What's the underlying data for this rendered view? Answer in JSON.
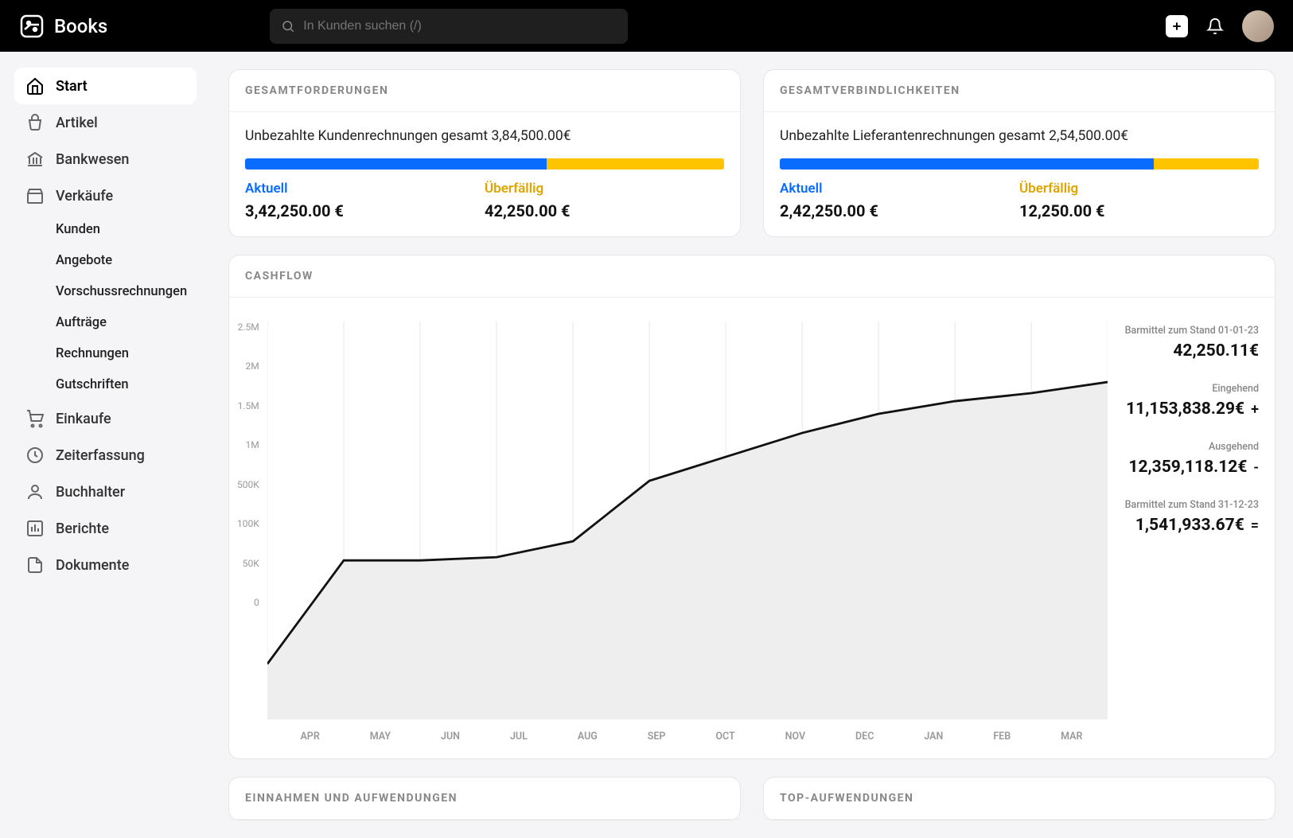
{
  "brand": "Books",
  "search": {
    "placeholder": "In Kunden suchen (/)"
  },
  "sidebar": {
    "items": [
      {
        "label": "Start",
        "icon": "home",
        "active": true
      },
      {
        "label": "Artikel",
        "icon": "basket"
      },
      {
        "label": "Bankwesen",
        "icon": "bank"
      },
      {
        "label": "Verkäufe",
        "icon": "store",
        "children": [
          "Kunden",
          "Angebote",
          "Vorschussrechnungen",
          "Aufträge",
          "Rechnungen",
          "Gutschriften"
        ]
      },
      {
        "label": "Einkaufe",
        "icon": "cart"
      },
      {
        "label": "Zeiterfassung",
        "icon": "clock"
      },
      {
        "label": "Buchhalter",
        "icon": "person"
      },
      {
        "label": "Berichte",
        "icon": "chart"
      },
      {
        "label": "Dokumente",
        "icon": "file"
      }
    ]
  },
  "receivables": {
    "title": "GESAMTFORDERUNGEN",
    "summary": "Unbezahlte Kundenrechnungen gesamt 3,84,500.00€",
    "current_label": "Aktuell",
    "current_value": "3,42,250.00 €",
    "overdue_label": "Überfällig",
    "overdue_value": "42,250.00 €",
    "bar_split_pct": 63
  },
  "payables": {
    "title": "GESAMTVERBINDLICHKEITEN",
    "summary": "Unbezahlte Lieferantenrechnungen gesamt 2,54,500.00€",
    "current_label": "Aktuell",
    "current_value": "2,42,250.00 €",
    "overdue_label": "Überfällig",
    "overdue_value": "12,250.00 €",
    "bar_split_pct": 78
  },
  "cashflow": {
    "title": "CASHFLOW",
    "opening_label": "Barmittel zum Stand 01-01-23",
    "opening_value": "42,250.11€",
    "incoming_label": "Eingehend",
    "incoming_value": "11,153,838.29€",
    "outgoing_label": "Ausgehend",
    "outgoing_value": "12,359,118.12€",
    "closing_label": "Barmittel zum Stand 31-12-23",
    "closing_value": "1,541,933.67€"
  },
  "income_expense": {
    "title": "EINNAHMEN UND AUFWENDUNGEN"
  },
  "top_expenses": {
    "title": "TOP-AUFWENDUNGEN"
  },
  "chart_data": {
    "type": "area",
    "title": "CASHFLOW",
    "xlabel": "",
    "ylabel": "",
    "ylim": [
      0,
      2500000
    ],
    "yaxis_ticks": [
      "2.5M",
      "2M",
      "1.5M",
      "1M",
      "500K",
      "100K",
      "50K",
      "0"
    ],
    "categories": [
      "APR",
      "MAY",
      "JUN",
      "JUL",
      "AUG",
      "SEP",
      "OCT",
      "NOV",
      "DEC",
      "JAN",
      "FEB",
      "MAR"
    ],
    "values": [
      350000,
      1000000,
      1000000,
      1020000,
      1120000,
      1500000,
      1650000,
      1800000,
      1920000,
      2000000,
      2050000,
      2120000
    ]
  }
}
